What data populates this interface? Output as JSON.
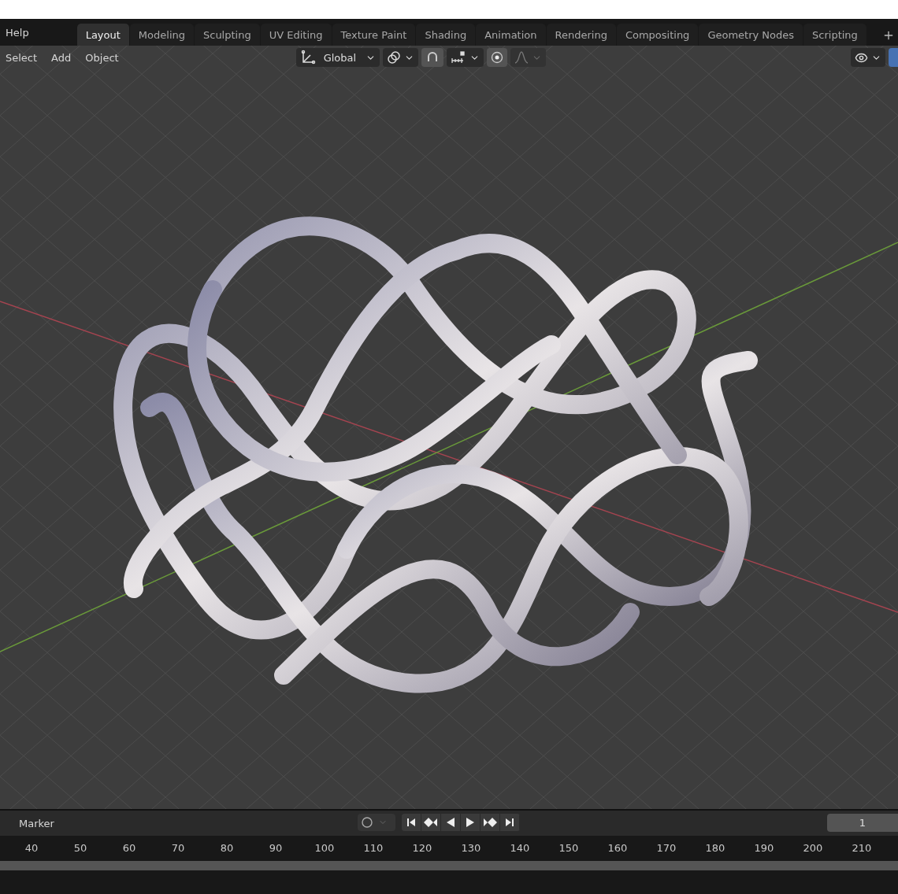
{
  "top_bar": {
    "menu": [
      "Help"
    ],
    "workspace_tabs": [
      {
        "label": "Layout",
        "selected": true
      },
      {
        "label": "Modeling",
        "selected": false
      },
      {
        "label": "Sculpting",
        "selected": false
      },
      {
        "label": "UV Editing",
        "selected": false
      },
      {
        "label": "Texture Paint",
        "selected": false
      },
      {
        "label": "Shading",
        "selected": false
      },
      {
        "label": "Animation",
        "selected": false
      },
      {
        "label": "Rendering",
        "selected": false
      },
      {
        "label": "Compositing",
        "selected": false
      },
      {
        "label": "Geometry Nodes",
        "selected": false
      },
      {
        "label": "Scripting",
        "selected": false
      }
    ]
  },
  "viewport_header": {
    "menu": [
      "Select",
      "Add",
      "Object"
    ],
    "orientation": "Global",
    "snap": {
      "on": true
    },
    "proportional_editing": {
      "on": true
    }
  },
  "timeline": {
    "menu": [
      "Marker"
    ],
    "current_frame": "1",
    "ruler": [
      "40",
      "50",
      "60",
      "70",
      "80",
      "90",
      "100",
      "110",
      "120",
      "130",
      "140",
      "150",
      "160",
      "170",
      "180",
      "190",
      "200",
      "210"
    ]
  }
}
